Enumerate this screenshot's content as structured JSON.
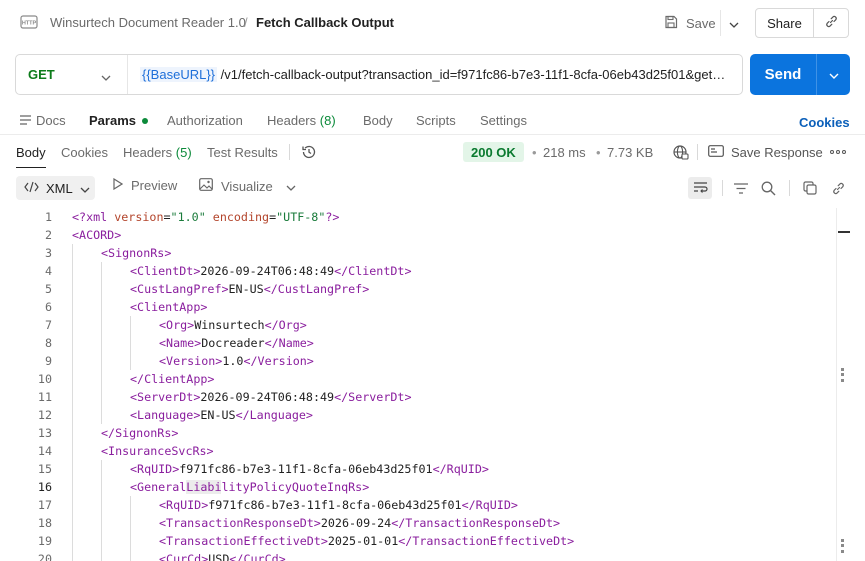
{
  "header": {
    "breadcrumb_parent": "Winsurtech Document Reader 1.0",
    "breadcrumb_sep": "/",
    "title": "Fetch Callback Output",
    "save_label": "Save",
    "share_label": "Share"
  },
  "request": {
    "method": "GET",
    "url_variable": "{{BaseURL}}",
    "url_path": " /v1/fetch-callback-output?transaction_id=f971fc86-b7e3-11f1-8cfa-06eb43d25f01&get_p...",
    "send_label": "Send"
  },
  "request_tabs": {
    "docs": "Docs",
    "params": "Params",
    "authorization": "Authorization",
    "headers": "Headers",
    "headers_count": "(8)",
    "body": "Body",
    "scripts": "Scripts",
    "settings": "Settings",
    "cookies": "Cookies"
  },
  "response_tabs": {
    "body": "Body",
    "cookies": "Cookies",
    "headers": "Headers",
    "headers_count": "(5)",
    "test_results": "Test Results"
  },
  "response_meta": {
    "status": "200 OK",
    "time": "218 ms",
    "size": "7.73 KB",
    "save_response": "Save Response",
    "dot": "•"
  },
  "toolbar": {
    "format": "XML",
    "preview": "Preview",
    "visualize": "Visualize"
  },
  "colors": {
    "accent": "#0b74de",
    "status_ok": "#0a7a2f",
    "xml_tag": "#8a1e9e",
    "xml_attr": "#b3452c",
    "xml_string": "#1a7b3b"
  },
  "code_lines": [
    {
      "n": "1",
      "indent": 0,
      "parts": [
        [
          "tg",
          "<?xml "
        ],
        [
          "at",
          "version"
        ],
        [
          "tx",
          "="
        ],
        [
          "st",
          "\"1.0\""
        ],
        [
          "tx",
          " "
        ],
        [
          "at",
          "encoding"
        ],
        [
          "tx",
          "="
        ],
        [
          "st",
          "\"UTF-8\""
        ],
        [
          "tg",
          "?>"
        ]
      ]
    },
    {
      "n": "2",
      "indent": 0,
      "parts": [
        [
          "tg",
          "<ACORD>"
        ]
      ]
    },
    {
      "n": "3",
      "indent": 1,
      "parts": [
        [
          "tg",
          "<SignonRs>"
        ]
      ]
    },
    {
      "n": "4",
      "indent": 2,
      "parts": [
        [
          "tg",
          "<ClientDt>"
        ],
        [
          "tx",
          "2026-09-24T06:48:49"
        ],
        [
          "tg",
          "</ClientDt>"
        ]
      ]
    },
    {
      "n": "5",
      "indent": 2,
      "parts": [
        [
          "tg",
          "<CustLangPref>"
        ],
        [
          "tx",
          "EN-US"
        ],
        [
          "tg",
          "</CustLangPref>"
        ]
      ]
    },
    {
      "n": "6",
      "indent": 2,
      "parts": [
        [
          "tg",
          "<ClientApp>"
        ]
      ]
    },
    {
      "n": "7",
      "indent": 3,
      "parts": [
        [
          "tg",
          "<Org>"
        ],
        [
          "tx",
          "Winsurtech"
        ],
        [
          "tg",
          "</Org>"
        ]
      ]
    },
    {
      "n": "8",
      "indent": 3,
      "parts": [
        [
          "tg",
          "<Name>"
        ],
        [
          "tx",
          "Docreader"
        ],
        [
          "tg",
          "</Name>"
        ]
      ]
    },
    {
      "n": "9",
      "indent": 3,
      "parts": [
        [
          "tg",
          "<Version>"
        ],
        [
          "tx",
          "1.0"
        ],
        [
          "tg",
          "</Version>"
        ]
      ]
    },
    {
      "n": "10",
      "indent": 2,
      "parts": [
        [
          "tg",
          "</ClientApp>"
        ]
      ]
    },
    {
      "n": "11",
      "indent": 2,
      "parts": [
        [
          "tg",
          "<ServerDt>"
        ],
        [
          "tx",
          "2026-09-24T06:48:49"
        ],
        [
          "tg",
          "</ServerDt>"
        ]
      ]
    },
    {
      "n": "12",
      "indent": 2,
      "parts": [
        [
          "tg",
          "<Language>"
        ],
        [
          "tx",
          "EN-US"
        ],
        [
          "tg",
          "</Language>"
        ]
      ]
    },
    {
      "n": "13",
      "indent": 1,
      "parts": [
        [
          "tg",
          "</SignonRs>"
        ]
      ]
    },
    {
      "n": "14",
      "indent": 1,
      "parts": [
        [
          "tg",
          "<InsuranceSvcRs>"
        ]
      ]
    },
    {
      "n": "15",
      "indent": 2,
      "parts": [
        [
          "tg",
          "<RqUID>"
        ],
        [
          "tx",
          "f971fc86-b7e3-11f1-8cfa-06eb43d25f01"
        ],
        [
          "tg",
          "</RqUID>"
        ]
      ]
    },
    {
      "n": "16",
      "indent": 2,
      "current": true,
      "parts": [
        [
          "tg",
          "<General"
        ],
        [
          "tg hl",
          "Liabi"
        ],
        [
          "tg",
          "lityPolicyQuoteInqRs>"
        ]
      ]
    },
    {
      "n": "17",
      "indent": 3,
      "parts": [
        [
          "tg",
          "<RqUID>"
        ],
        [
          "tx",
          "f971fc86-b7e3-11f1-8cfa-06eb43d25f01"
        ],
        [
          "tg",
          "</RqUID>"
        ]
      ]
    },
    {
      "n": "18",
      "indent": 3,
      "parts": [
        [
          "tg",
          "<TransactionResponseDt>"
        ],
        [
          "tx",
          "2026-09-24"
        ],
        [
          "tg",
          "</TransactionResponseDt>"
        ]
      ]
    },
    {
      "n": "19",
      "indent": 3,
      "parts": [
        [
          "tg",
          "<TransactionEffectiveDt>"
        ],
        [
          "tx",
          "2025-01-01"
        ],
        [
          "tg",
          "</TransactionEffectiveDt>"
        ]
      ]
    },
    {
      "n": "20",
      "indent": 3,
      "parts": [
        [
          "tg",
          "<CurCd>"
        ],
        [
          "tx",
          "USD"
        ],
        [
          "tg",
          "</CurCd>"
        ]
      ]
    }
  ]
}
